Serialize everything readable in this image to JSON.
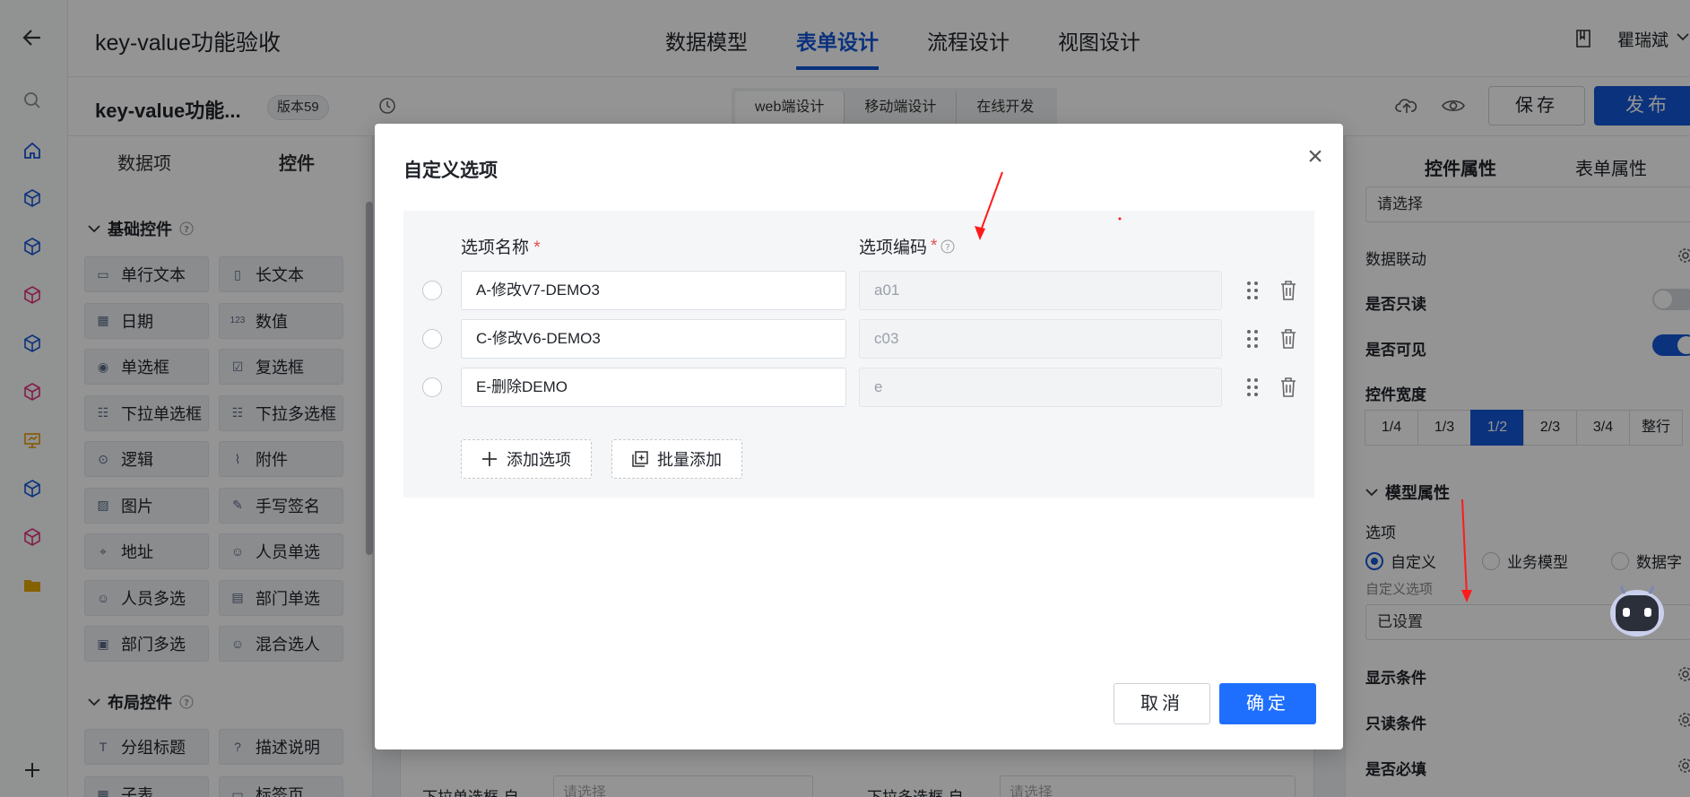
{
  "header": {
    "app_title": "key-value功能验收",
    "nav": [
      "数据模型",
      "表单设计",
      "流程设计",
      "视图设计"
    ],
    "active_nav": "表单设计",
    "user_name": "瞿瑞斌"
  },
  "toolbar": {
    "form_name": "key-value功能...",
    "version": "版本59",
    "modes": [
      "web端设计",
      "移动端设计",
      "在线开发"
    ],
    "save_label": "保存",
    "publish_label": "发布"
  },
  "left_panel": {
    "tabs": [
      "数据项",
      "控件"
    ],
    "basic_section": "基础控件",
    "basic_controls": [
      "单行文本",
      "长文本",
      "日期",
      "数值",
      "单选框",
      "复选框",
      "下拉单选框",
      "下拉多选框",
      "逻辑",
      "附件",
      "图片",
      "手写签名",
      "地址",
      "人员单选",
      "人员多选",
      "部门单选",
      "部门多选",
      "混合选人"
    ],
    "layout_section": "布局控件",
    "layout_controls": [
      "分组标题",
      "描述说明",
      "子表",
      "标签页"
    ]
  },
  "canvas": {
    "field_left": "下拉单选框-自",
    "field_right": "下拉多选框-自",
    "placeholder": "请选择"
  },
  "right_panel": {
    "tabs": [
      "控件属性",
      "表单属性"
    ],
    "placeholder_value": "请选择",
    "data_linkage": "数据联动",
    "read_only": "是否只读",
    "visible": "是否可见",
    "width_label": "控件宽度",
    "width_options": [
      "1/4",
      "1/3",
      "1/2",
      "2/3",
      "3/4",
      "整行"
    ],
    "active_width": "1/2",
    "model_section": "模型属性",
    "options_label": "选项",
    "option_sources": [
      "自定义",
      "业务模型",
      "数据字"
    ],
    "custom_options_label": "自定义选项",
    "custom_options_value": "已设置",
    "display_condition": "显示条件",
    "readonly_condition": "只读条件",
    "required": "是否必填"
  },
  "modal": {
    "title": "自定义选项",
    "col_name": "选项名称",
    "col_code": "选项编码",
    "required_mark": "*",
    "rows": [
      {
        "name": "A-修改V7-DEMO3",
        "code": "a01"
      },
      {
        "name": "C-修改V6-DEMO3",
        "code": "c03"
      },
      {
        "name": "E-删除DEMO",
        "code": "e"
      }
    ],
    "add_option": "添加选项",
    "batch_add": "批量添加",
    "cancel": "取消",
    "confirm": "确定"
  },
  "colors": {
    "primary": "#1456d8",
    "confirm": "#1f6fff",
    "annotation_arrow": "#ff1a1a"
  }
}
